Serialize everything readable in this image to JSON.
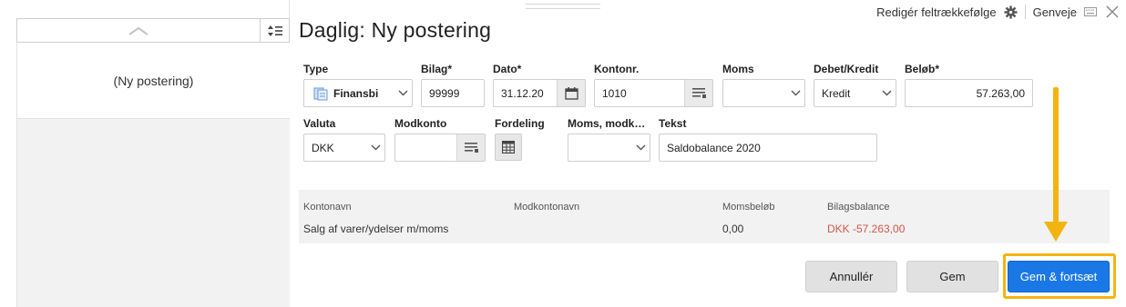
{
  "left_panel": {
    "new_entry_label": "(Ny postering)"
  },
  "toolbar": {
    "edit_field_order": "Redigér feltrækkefølge",
    "shortcuts": "Genveje"
  },
  "title": "Daglig: Ny postering",
  "form": {
    "type": {
      "label": "Type",
      "value": "Finansbi"
    },
    "bilag": {
      "label": "Bilag",
      "value": "99999"
    },
    "dato": {
      "label": "Dato",
      "value": "31.12.20"
    },
    "kontonr": {
      "label": "Kontonr.",
      "value": "1010"
    },
    "moms": {
      "label": "Moms",
      "value": ""
    },
    "debet_kredit": {
      "label": "Debet/Kredit",
      "value": "Kredit"
    },
    "beloeb": {
      "label": "Beløb",
      "value": "57.263,00"
    },
    "valuta": {
      "label": "Valuta",
      "value": "DKK"
    },
    "modkonto": {
      "label": "Modkonto",
      "value": ""
    },
    "fordeling": {
      "label": "Fordeling"
    },
    "moms_modk": {
      "label": "Moms, modk…",
      "value": ""
    },
    "tekst": {
      "label": "Tekst",
      "value": "Saldobalance 2020"
    },
    "required_mark": "*"
  },
  "info": {
    "headers": {
      "kontonavn": "Kontonavn",
      "modkontonavn": "Modkontonavn",
      "momsbeloeb": "Momsbeløb",
      "bilagsbalance": "Bilagsbalance"
    },
    "values": {
      "kontonavn": "Salg af varer/ydelser m/moms",
      "modkontonavn": "",
      "momsbeloeb": "0,00",
      "bilagsbalance": "DKK -57.263,00"
    }
  },
  "buttons": {
    "cancel": "Annullér",
    "save": "Gem",
    "save_continue": "Gem & fortsæt"
  },
  "colors": {
    "primary": "#1a78e6",
    "annotation": "#f3b411",
    "negative": "#d2574a"
  }
}
